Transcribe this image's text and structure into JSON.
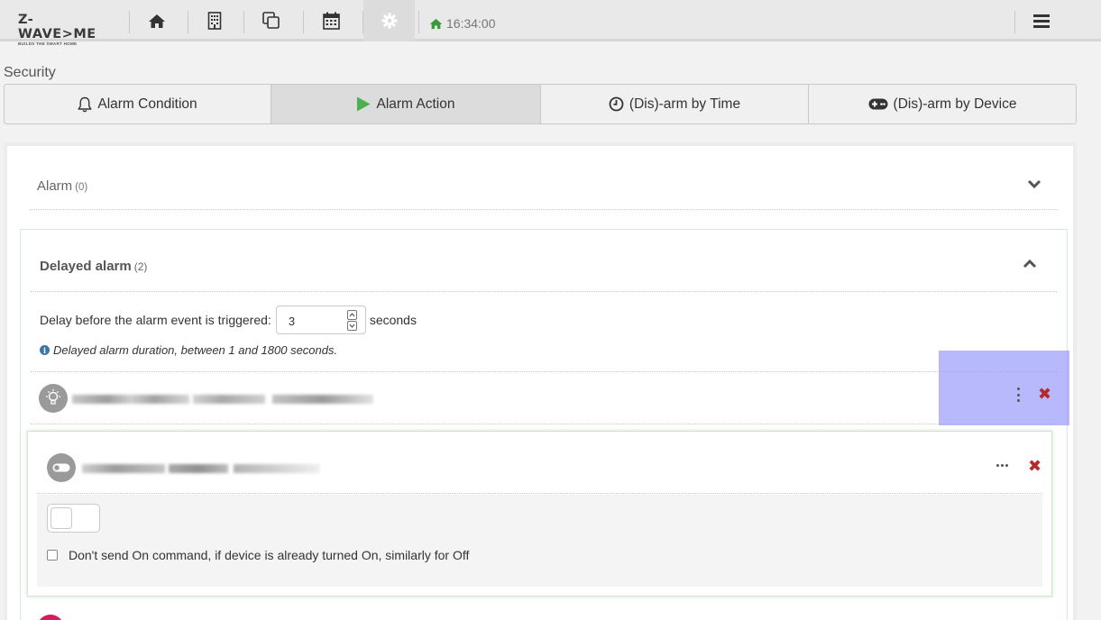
{
  "app": {
    "logo_text": "Z-WAVE>ME",
    "logo_tagline": "BUILDS THE SMART HOME",
    "clock": "16:34:00",
    "nav_icons": [
      "home-icon",
      "building-icon",
      "copy-icon",
      "calendar-icon",
      "gear-icon"
    ],
    "menu_icon": "hamburger-icon"
  },
  "page": {
    "title": "Security"
  },
  "tabs": [
    {
      "label": "Alarm Condition",
      "icon": "bell-icon",
      "active": false
    },
    {
      "label": "Alarm Action",
      "icon": "play-icon",
      "active": true
    },
    {
      "label": "(Dis)-arm by Time",
      "icon": "clock-icon",
      "active": false
    },
    {
      "label": "(Dis)-arm by Device",
      "icon": "gamepad-icon",
      "active": false
    }
  ],
  "alarm": {
    "label": "Alarm",
    "count": "(0)"
  },
  "delayed_alarm": {
    "label": "Delayed alarm",
    "count": "(2)",
    "delay_label": "Delay before the alarm event is triggered:",
    "delay_value": "3",
    "delay_unit": "seconds",
    "hint": "Delayed alarm duration, between 1 and 1800 seconds."
  },
  "action": {
    "checkbox_label": "Don't send On command, if device is already turned On, similarly for Off"
  },
  "colors": {
    "accent_green": "#3a9a3a",
    "delete_red": "#b52b2b",
    "highlight": "#8c8cfa"
  }
}
